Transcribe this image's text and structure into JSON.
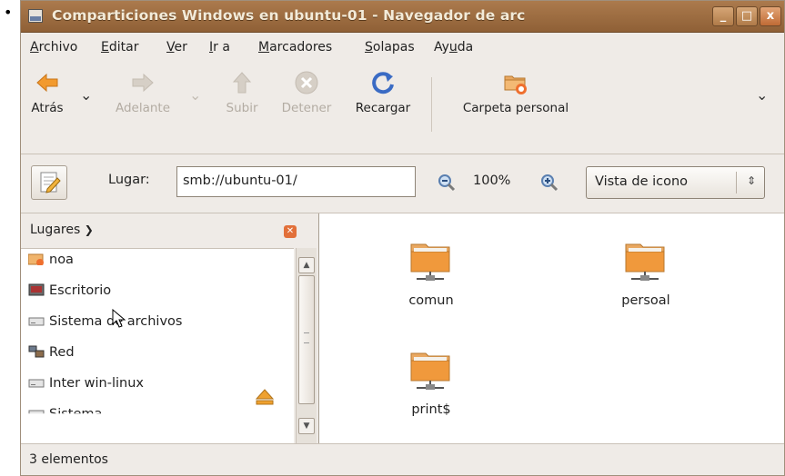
{
  "window": {
    "title": "Comparticiones Windows en ubuntu-01 - Navegador de arc",
    "controls": {
      "minimize": "_",
      "maximize": "□",
      "close": "x"
    }
  },
  "menubar": {
    "items": [
      {
        "pre": "",
        "ul": "A",
        "post": "rchivo"
      },
      {
        "pre": "",
        "ul": "E",
        "post": "ditar"
      },
      {
        "pre": "",
        "ul": "V",
        "post": "er"
      },
      {
        "pre": "",
        "ul": "I",
        "post": "r a"
      },
      {
        "pre": "",
        "ul": "M",
        "post": "arcadores"
      },
      {
        "pre": "",
        "ul": "S",
        "post": "olapas"
      },
      {
        "pre": "Ay",
        "ul": "u",
        "post": "da"
      }
    ]
  },
  "toolbar": {
    "back": "Atrás",
    "forward": "Adelante",
    "up": "Subir",
    "stop": "Detener",
    "reload": "Recargar",
    "home": "Carpeta personal"
  },
  "location": {
    "label": "Lugar:",
    "value": "smb://ubuntu-01/",
    "zoom": "100%",
    "view": "Vista de icono"
  },
  "sidebar": {
    "header": "Lugares",
    "places": [
      {
        "label": "noa",
        "icon": "home-folder-icon"
      },
      {
        "label": "Escritorio",
        "icon": "desktop-icon"
      },
      {
        "label": "Sistema de archivos",
        "icon": "drive-icon"
      },
      {
        "label": "Red",
        "icon": "network-icon"
      },
      {
        "label": "Inter win-linux",
        "icon": "drive-icon"
      },
      {
        "label": "Sistema",
        "icon": "drive-icon"
      }
    ]
  },
  "content": {
    "items": [
      {
        "label": "comun"
      },
      {
        "label": "persoal"
      },
      {
        "label": "print$"
      }
    ]
  },
  "status": {
    "text": "3 elementos"
  },
  "colors": {
    "titlebar": "#9a6a3f",
    "folder": "#f0993c",
    "accent": "#e2703a"
  }
}
